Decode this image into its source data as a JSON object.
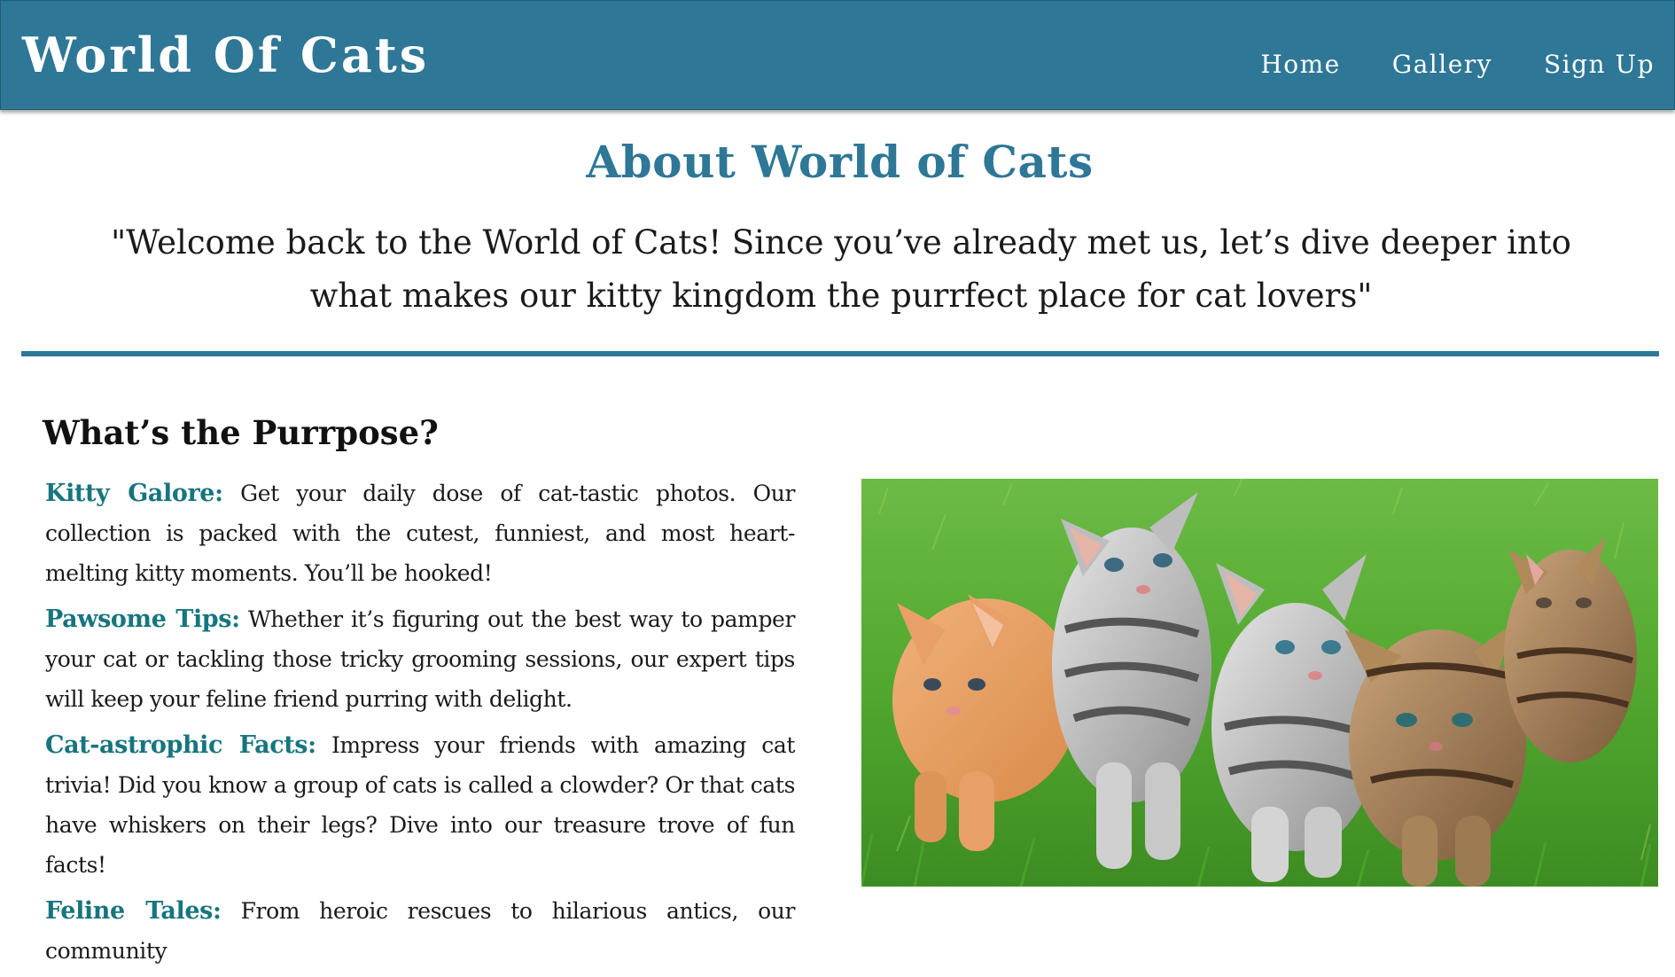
{
  "header": {
    "site_title": "World Of Cats",
    "nav": [
      {
        "label": "Home"
      },
      {
        "label": "Gallery"
      },
      {
        "label": "Sign Up"
      }
    ]
  },
  "about": {
    "title": "About World of Cats",
    "quote": "\"Welcome back to the World of Cats! Since you’ve already met us, let’s dive deeper into what makes our kitty kingdom the purrfect place for cat lovers\""
  },
  "purpose": {
    "heading": "What’s the Purrpose?",
    "features": [
      {
        "name": "Kitty Galore:",
        "text": " Get your daily dose of cat-tastic photos. Our collection is packed with the cutest, funniest, and most heart-melting kitty moments. You’ll be hooked!"
      },
      {
        "name": "Pawsome Tips:",
        "text": " Whether it’s figuring out the best way to pamper your cat or tackling those tricky grooming sessions, our expert tips will keep your feline friend purring with delight."
      },
      {
        "name": "Cat-astrophic Facts:",
        "text": " Impress your friends with amazing cat trivia! Did you know a group of cats is called a clowder? Or that cats have whiskers on their legs? Dive into our treasure trove of fun facts!"
      },
      {
        "name": "Feline Tales:",
        "text": " From heroic rescues to hilarious antics, our community"
      }
    ]
  },
  "image": {
    "kind": "photo of five kittens on grass"
  },
  "colors": {
    "header_bg": "#2e7796",
    "accent": "#2e7796",
    "feature_name": "#16757e"
  }
}
